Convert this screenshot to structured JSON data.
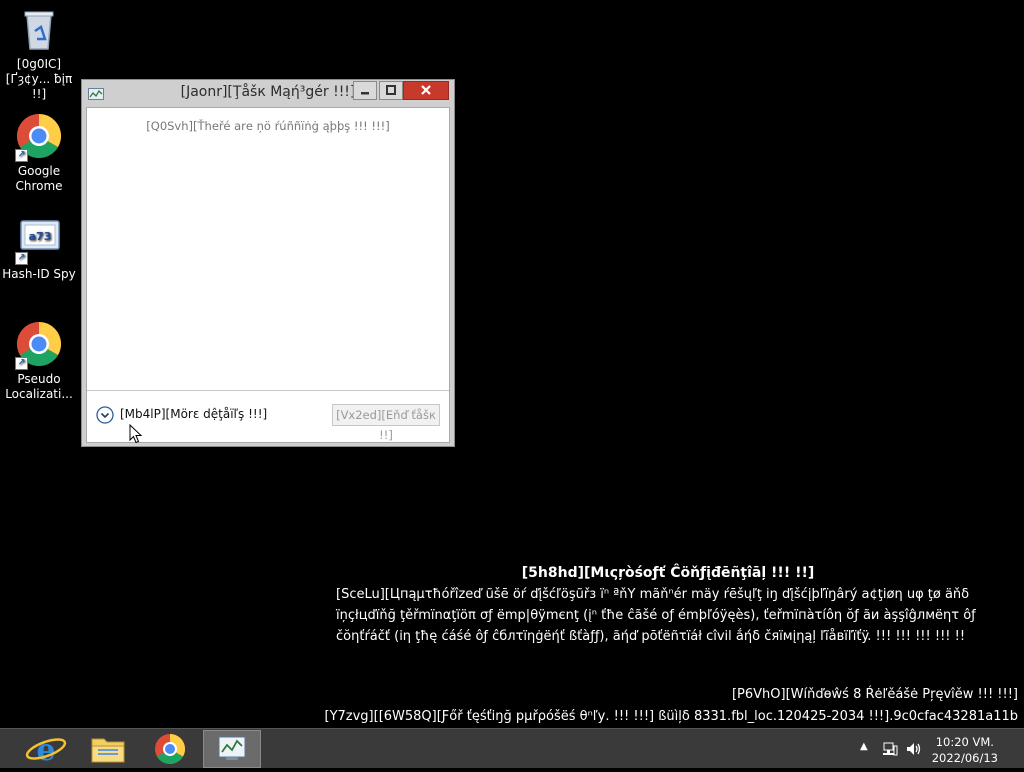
{
  "desktop": {
    "icons": [
      {
        "label": "[0g0IC][Ґȝ¢у... ƀįπ !!]",
        "icon": "recycle-bin-icon"
      },
      {
        "label": "Google Chrome",
        "icon": "chrome-icon"
      },
      {
        "label": "Hash-ID Spy",
        "icon": "hash-id-spy-icon",
        "glyph": "a73"
      },
      {
        "label": "Pseudo Localizati...",
        "icon": "chrome-icon"
      }
    ]
  },
  "task_manager": {
    "title": "[Jaonr][Ţåšк Mąή³gér !!!]",
    "empty_message": "[Q0Svh][Ťhеřé arе ņö ŕúññïṅġ ąþþş !!! !!!]",
    "more_details": "[Mb4lP][Mörε dệţåïľş !!!]",
    "end_task": "[Vx2ed][Eňď ťåšк !!]"
  },
  "watermark": {
    "heading": "[5h8hd][Μιςŗòśοƒť Ĉöňƒįđēñţîāļ !!! !!]",
    "body": "[SceLu][Цпąμτħóřîzeď ũšē öŕ ďįšćľöşũřз ïⁿ ªňY mãňⁿér mäy ŕēšųľţ iŋ ďįšćįþľïŋârý a¢ţіøη սφ ţø äňδ ïņçłцďïňğ ţěřmïnαţїöπ σƒ ëmp|θÿmєnţ (įⁿ ťħe ĉãšé оƒ émþľóÿęès), ťеřmïпàτíôη ŏƒ ãи àşşîĝлмëητ ôƒ čŏηťŕáčť (iη ţħę ćáśé ôƒ ĉблτïηġëήť ßťàƒƒ), ãήď pōťëñτïáł cîvіl ắήδ čяïмįηąļ ľĩåвїľïťÿ. !!! !!! !!! !!! !!",
    "build": "[P6VhO][Wíňďөŵś 8 Ŕėľěášė Pŗęvîěw !!! !!!]",
    "test_line": "[Y7zvg][[6W58Q][Ƒőř ťęśťiŋğ pμřρόšëś θⁿľу. !!! !!!] ßüìļδ 8331.fbl_loc.120425-2034 !!!].9c0cfac43281a11b"
  },
  "taskbar": {
    "apps": [
      {
        "name": "internet-explorer",
        "icon": "ie-icon"
      },
      {
        "name": "file-explorer",
        "icon": "folder-icon"
      },
      {
        "name": "chrome",
        "icon": "chrome-icon"
      },
      {
        "name": "task-manager",
        "icon": "task-manager-icon",
        "active": true
      }
    ],
    "clock_time": "10:20 VM.",
    "clock_date": "2022/06/13"
  }
}
